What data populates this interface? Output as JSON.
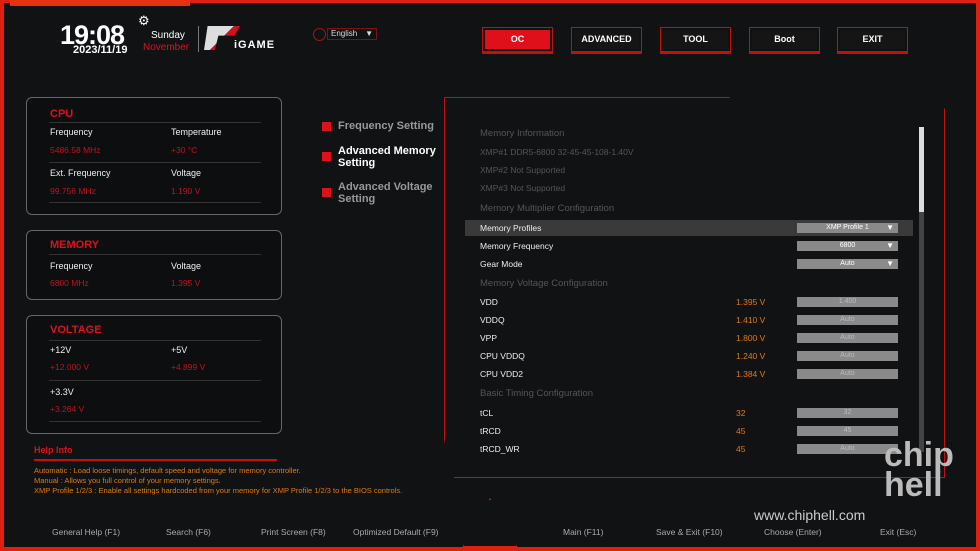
{
  "header": {
    "time": "19:08",
    "date": "2023/11/19",
    "day": "Sunday",
    "month": "November",
    "logo_text": "iGAME",
    "language": "English"
  },
  "tabs": [
    {
      "label": "OC",
      "active": true
    },
    {
      "label": "ADVANCED"
    },
    {
      "label": "TOOL"
    },
    {
      "label": "Boot"
    },
    {
      "label": "EXIT"
    }
  ],
  "cpu": {
    "title": "CPU",
    "frequency_label": "Frequency",
    "frequency": "5486.58 MHz",
    "temperature_label": "Temperature",
    "temperature": "+30 °C",
    "ext_label": "Ext. Frequency",
    "ext": "99.756 MHz",
    "voltage_label": "Voltage",
    "voltage": "1.190 V"
  },
  "memory": {
    "title": "MEMORY",
    "frequency_label": "Frequency",
    "frequency": "6800 MHz",
    "voltage_label": "Voltage",
    "voltage": "1.395 V"
  },
  "voltage": {
    "title": "VOLTAGE",
    "v12_label": "+12V",
    "v12": "+12.000 V",
    "v5_label": "+5V",
    "v5": "+4.899 V",
    "v33_label": "+3.3V",
    "v33": "+3.264 V"
  },
  "menu": [
    {
      "line1": "Frequency Setting",
      "line2": ""
    },
    {
      "line1": "Advanced Memory",
      "line2": "Setting",
      "selected": true
    },
    {
      "line1": "Advanced Voltage",
      "line2": "Setting"
    }
  ],
  "settings": {
    "h_info": "Memory Information",
    "xmp1": "XMP#1 DDR5-6800 32-45-45-108-1.40V",
    "xmp2": "XMP#2 Not Supported",
    "xmp3": "XMP#3 Not Supported",
    "h_mult": "Memory Multiplier Configuration",
    "profiles": {
      "label": "Memory Profiles",
      "value": "XMP Profile 1"
    },
    "frequency": {
      "label": "Memory Frequency",
      "value": "6800"
    },
    "gear": {
      "label": "Gear Mode",
      "value": "Auto"
    },
    "h_volt": "Memory Voltage Configuration",
    "vdd": {
      "label": "VDD",
      "current": "1.395 V",
      "value": "1.400"
    },
    "vddq": {
      "label": "VDDQ",
      "current": "1.410 V",
      "value": "Auto"
    },
    "vpp": {
      "label": "VPP",
      "current": "1.800 V",
      "value": "Auto"
    },
    "cpu_vddq": {
      "label": "CPU VDDQ",
      "current": "1.240 V",
      "value": "Auto"
    },
    "cpu_vdd2": {
      "label": "CPU VDD2",
      "current": "1.384 V",
      "value": "Auto"
    },
    "h_timing": "Basic Timing Configuration",
    "tcl": {
      "label": "tCL",
      "current": "32",
      "value": "32"
    },
    "trcd": {
      "label": "tRCD",
      "current": "45",
      "value": "45"
    },
    "trcd_wr": {
      "label": "tRCD_WR",
      "current": "45",
      "value": "Auto"
    }
  },
  "help": {
    "title": "Help Info",
    "lines": [
      "Automatic : Load loose timings, default speed and voltage for memory controller.",
      "Manual : Allows you full control of your memory settings.",
      "XMP Profile 1/2/3 : Enable all settings hardcoded from your memory for XMP Profile 1/2/3 to the BIOS controls."
    ]
  },
  "footer": [
    "General Help (F1)",
    "Search (F6)",
    "Print Screen (F8)",
    "Optimized Default (F9)",
    "Main (F11)",
    "Save & Exit (F10)",
    "Choose (Enter)",
    "Exit (Esc)"
  ],
  "watermark": {
    "url": "www.chiphell.com",
    "logo": "chip hell"
  },
  "colors": {
    "accent": "#e0101a",
    "value": "#e07a10"
  }
}
